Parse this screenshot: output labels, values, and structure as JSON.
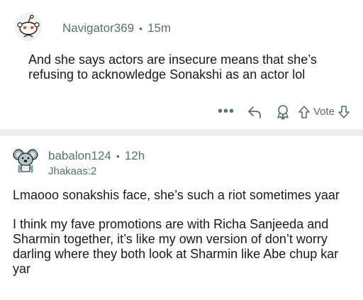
{
  "comments": [
    {
      "username": "Navigator369",
      "separator": "•",
      "time": "15m",
      "flair": "",
      "paragraphs": [
        "And she says actors are insecure means that she’s refusing to acknowledge Sonakshi as an actor lol"
      ],
      "actions": {
        "more": "•••",
        "vote_label": "Vote"
      },
      "avatar_icon": "snoo-avatar-icon"
    },
    {
      "username": "babalon124",
      "separator": "•",
      "time": "12h",
      "flair": "Jhakaas:2",
      "paragraphs": [
        "Lmaooo sonakshis face, she’s such a riot sometimes yaar",
        "I think my fave promotions are with Richa Sanjeeda and Sharmin together, it’s like my own version of don’t worry darling where they both look at Sharmin like Abe chup kar yar"
      ],
      "avatar_icon": "koala-avatar-icon"
    }
  ],
  "colors": {
    "text": "#1a1a1b",
    "meta": "#576f76",
    "separator_band": "#eeeeee",
    "snoo_eye": "#ff4500"
  }
}
